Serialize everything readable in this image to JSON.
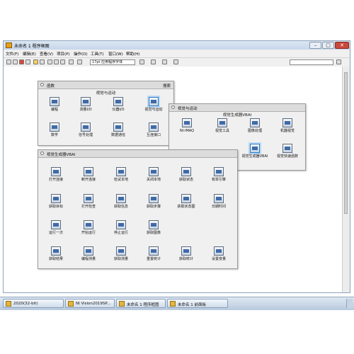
{
  "window": {
    "title": "未命名 1 程序框图",
    "buttons": {
      "minimize": "–",
      "maximize": "□",
      "close": "✕"
    }
  },
  "menubar": [
    "文件(F)",
    "编辑(E)",
    "查看(V)",
    "项目(P)",
    "操作(O)",
    "工具(T)",
    "窗口(W)",
    "帮助(H)"
  ],
  "toolbar": {
    "font_select": "17pt 应用程序字体",
    "search_placeholder": "",
    "help": "?"
  },
  "functions_palette": {
    "title": "函数",
    "search": "搜索",
    "subheading": "视觉与运动",
    "items": [
      "编程",
      "测量I/O",
      "仪器I/O",
      "视觉与运动",
      "数学",
      "信号处理",
      "数据通信",
      "互连接口"
    ]
  },
  "vision_palette": {
    "title": "视觉与运动",
    "subheading": "视觉生成器VBAI",
    "items": [
      "NI-IMAQ",
      "视觉工具",
      "图像处理",
      "机器视觉",
      "",
      "",
      "视觉生成器VBAI",
      "视觉快速函数"
    ]
  },
  "vbai_palette": {
    "title": "视觉生成器VBAI",
    "items": [
      "打开连接",
      "断开连接",
      "检试本地",
      "关闭本地",
      "获取状态",
      "枚举引擎",
      "获取目标",
      "打开检查",
      "获取信息",
      "获取步骤",
      "获取状态图",
      "日期时间",
      "运行一次",
      "开始运行",
      "停止运行",
      "获取图像",
      "获取结果",
      "编程测量",
      "获取测量",
      "重置统计",
      "获取统计",
      "设置变量"
    ]
  },
  "taskbar": {
    "items": [
      "2020(32-bit)",
      "NI Vision2019SP...",
      "未命名 1 程序框图",
      "未命名 1 前面板"
    ]
  }
}
